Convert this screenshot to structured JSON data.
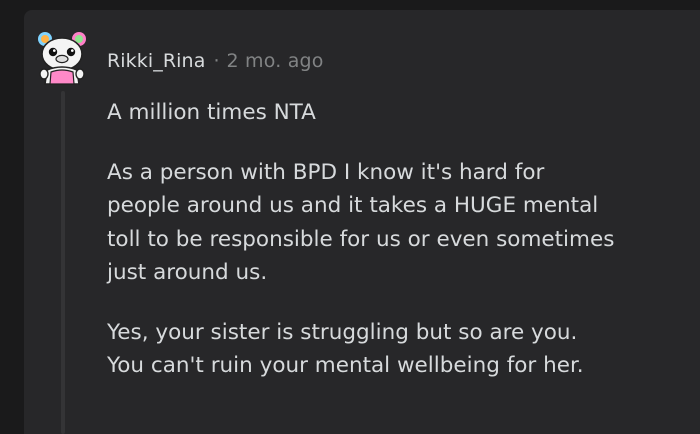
{
  "comment": {
    "author": "Rikki_Rina",
    "separator": "·",
    "timestamp": "2 mo. ago",
    "avatar": "snoo-avatar-icon",
    "paragraphs": [
      [
        "A million times NTA"
      ],
      [
        "As a person with BPD I know it's hard for",
        "people around us and it takes a HUGE mental",
        "toll to be responsible for us or even sometimes",
        "just around us."
      ],
      [
        "Yes, your sister is struggling but so are you.",
        "You can't ruin your mental wellbeing for her."
      ]
    ]
  },
  "colors": {
    "page_bg": "#1a1a1b",
    "card_bg": "#272729",
    "text": "#d7dadc",
    "meta_text": "#818384",
    "thread_line": "#343436"
  }
}
